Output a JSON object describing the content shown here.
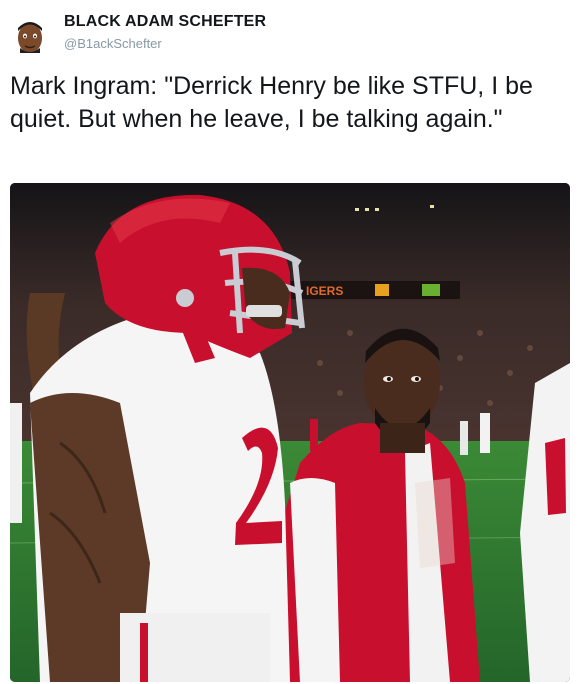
{
  "user": {
    "display_name": "BLACK ADAM SCHEFTER",
    "handle": "@B1ackSchefter",
    "avatar_icon": "cartoon-face-avatar-icon"
  },
  "tweet": {
    "text": "Mark Ingram: \"Derrick Henry be like STFU, I be quiet. But when he leave, I be talking again.\""
  },
  "media": {
    "scoreboard_text": "IGERS",
    "colors": {
      "crimson": "#c8102e",
      "field_green": "#2f7a2c",
      "crowd_dark": "#2a2120"
    }
  }
}
